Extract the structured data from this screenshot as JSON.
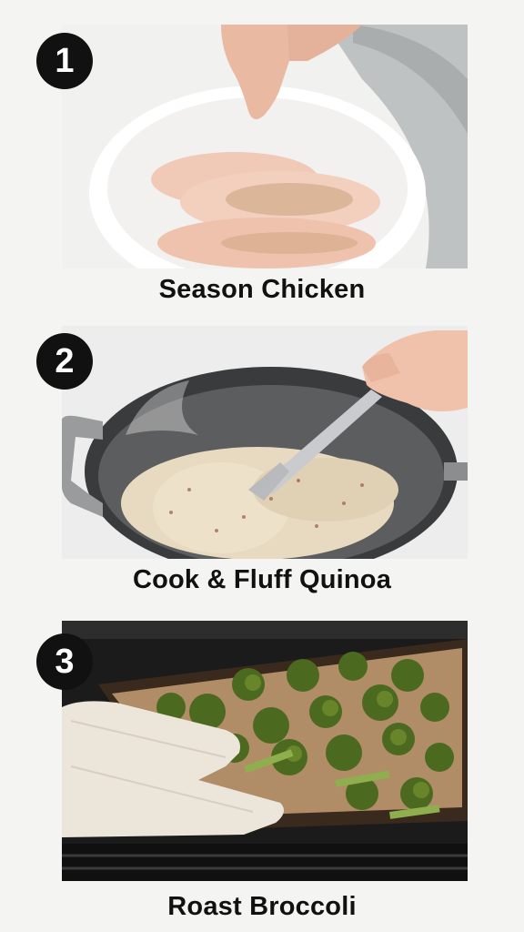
{
  "steps": [
    {
      "number": "1",
      "caption": "Season Chicken",
      "photo": "seasoning-raw-chicken-in-bowl"
    },
    {
      "number": "2",
      "caption": "Cook & Fluff Quinoa",
      "photo": "fluffing-quinoa-in-pot"
    },
    {
      "number": "3",
      "caption": "Roast Broccoli",
      "photo": "roasting-broccoli-in-oven"
    }
  ]
}
